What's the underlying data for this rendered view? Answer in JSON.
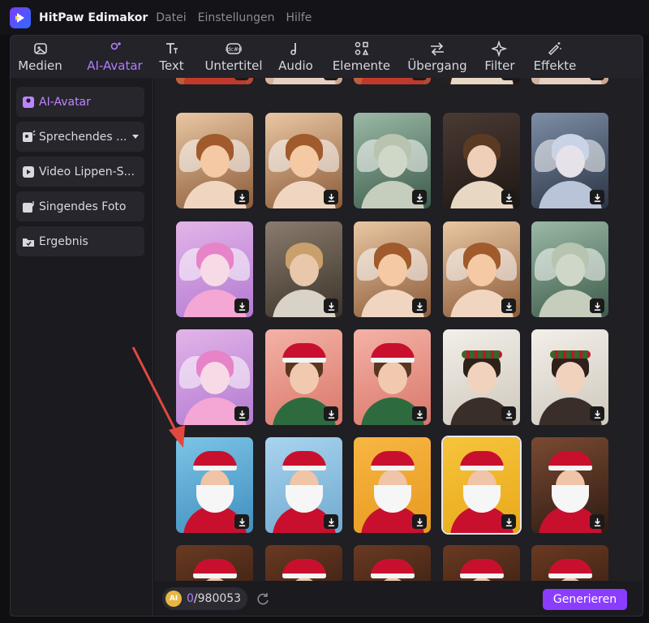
{
  "app": {
    "title": "HitPaw Edimakor"
  },
  "menu": [
    "Datei",
    "Einstellungen",
    "Hilfe"
  ],
  "toolbar": [
    {
      "label": "Medien",
      "icon": "media-icon",
      "active": false
    },
    {
      "label": "AI-Avatar",
      "icon": "avatar-icon",
      "active": true
    },
    {
      "label": "Text",
      "icon": "text-icon",
      "active": false
    },
    {
      "label": "Untertitel",
      "icon": "subtitle-icon",
      "active": false
    },
    {
      "label": "Audio",
      "icon": "audio-icon",
      "active": false
    },
    {
      "label": "Elemente",
      "icon": "elements-icon",
      "active": false
    },
    {
      "label": "Übergang",
      "icon": "transition-icon",
      "active": false
    },
    {
      "label": "Filter",
      "icon": "filter-icon",
      "active": false
    },
    {
      "label": "Effekte",
      "icon": "effects-icon",
      "active": false
    }
  ],
  "sidebar": [
    {
      "label": "AI-Avatar",
      "icon": "avatar-icon",
      "active": true,
      "dropdown": false
    },
    {
      "label": "Sprechendes ...",
      "icon": "talking-photo-icon",
      "active": false,
      "dropdown": true
    },
    {
      "label": "Video Lippen-S...",
      "icon": "video-lipsync-icon",
      "active": false,
      "dropdown": false
    },
    {
      "label": "Singendes Foto",
      "icon": "singing-photo-icon",
      "active": false,
      "dropdown": false
    },
    {
      "label": "Ergebnis",
      "icon": "result-icon",
      "active": false,
      "dropdown": false
    }
  ],
  "grid": {
    "rows": [
      [
        "cupid",
        "baby",
        "cupid",
        "girl",
        "baby"
      ],
      [
        "cupid-baby",
        "cupid-baby",
        "angel-statue",
        "girl",
        "angel-boy"
      ],
      [
        "anime-girl",
        "woman",
        "cupid-baby",
        "cupid-baby",
        "angel-statue"
      ],
      [
        "anime-girl",
        "santa-woman",
        "santa-woman",
        "wreath-woman",
        "wreath-woman"
      ],
      [
        "santa",
        "santa",
        "santa",
        "santa",
        "santa"
      ],
      [
        "santa",
        "santa",
        "santa",
        "santa",
        "santa"
      ]
    ],
    "selected": [
      4,
      3
    ]
  },
  "credits": {
    "badge": "AI",
    "used": "0",
    "total": "/980053"
  },
  "generate_label": "Generieren",
  "colors": {
    "accent": "#8a3dff",
    "active_text": "#b57bff"
  }
}
